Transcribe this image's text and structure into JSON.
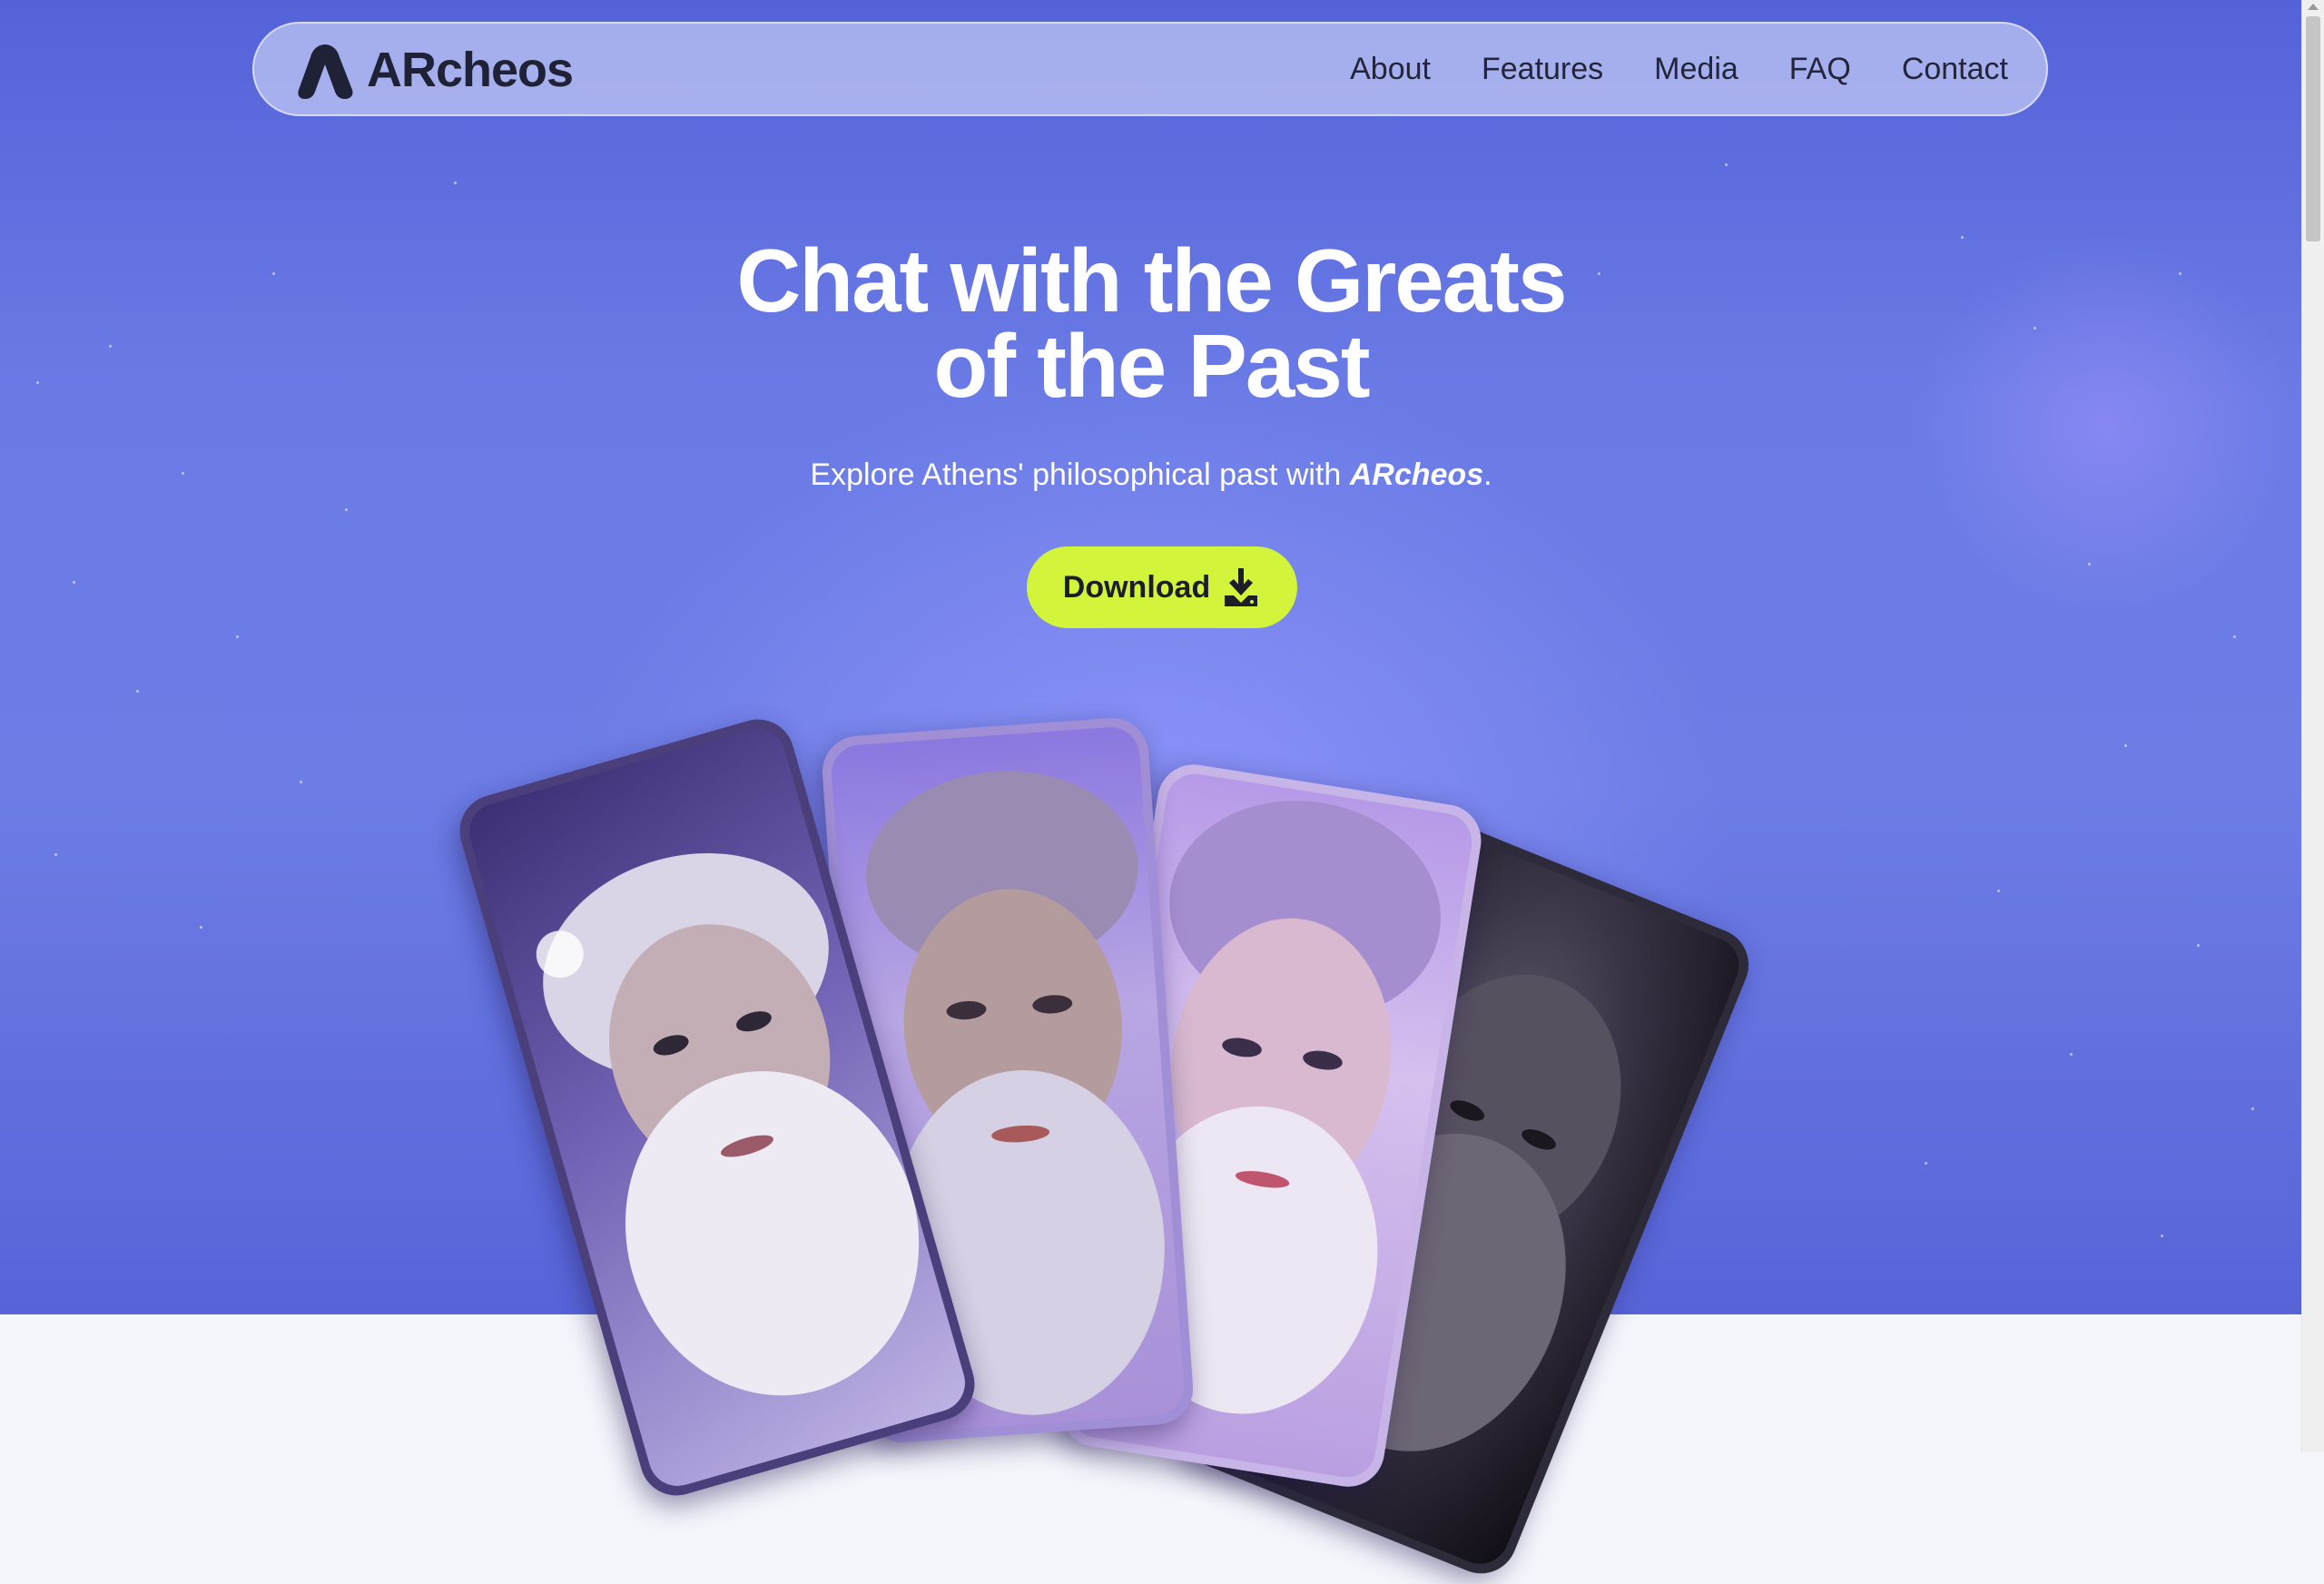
{
  "brand": {
    "name": "ARcheos"
  },
  "nav": {
    "links": [
      "About",
      "Features",
      "Media",
      "FAQ",
      "Contact"
    ]
  },
  "hero": {
    "headline_line1": "Chat with the Greats",
    "headline_line2": "of the Past",
    "subtitle_prefix": "Explore Athens' philosophical past with ",
    "subtitle_brand": "ARcheos",
    "subtitle_suffix": ".",
    "cta_label": "Download"
  },
  "colors": {
    "hero_bg": "#6a7be6",
    "cta_bg": "#d2f43a",
    "text_light": "#ffffff",
    "nav_text": "#23253a"
  },
  "icons": [
    "archeos-logo-icon",
    "download-icon"
  ],
  "images": [
    "phone-socrates",
    "phone-plato",
    "phone-aristotle",
    "phone-philosopher"
  ]
}
